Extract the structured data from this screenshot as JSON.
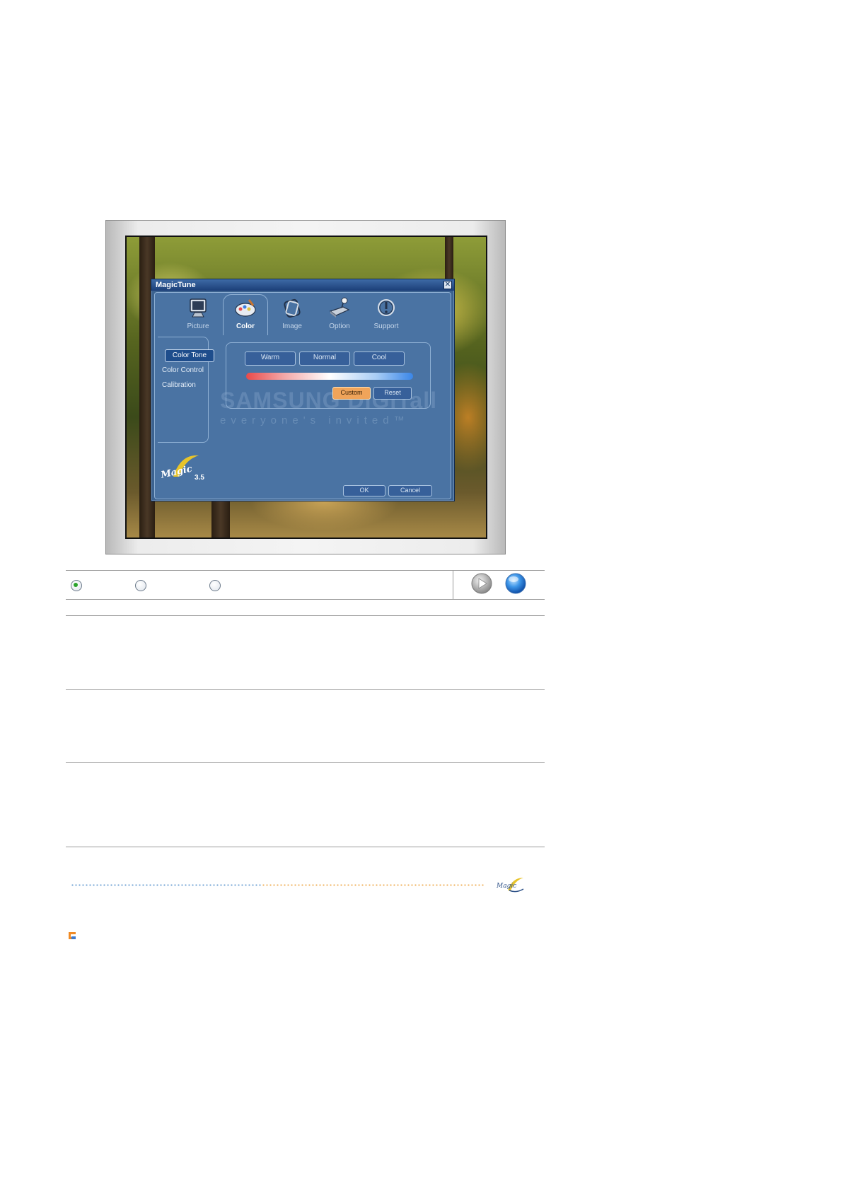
{
  "window": {
    "title": "MagicTune",
    "close_glyph": "✕",
    "version": "3.5"
  },
  "tabs": [
    {
      "label": "Picture",
      "icon": "monitor-icon"
    },
    {
      "label": "Color",
      "icon": "palette-icon"
    },
    {
      "label": "Image",
      "icon": "image-icon"
    },
    {
      "label": "Option",
      "icon": "option-icon"
    },
    {
      "label": "Support",
      "icon": "support-icon"
    }
  ],
  "active_tab": "Color",
  "side_menu": [
    {
      "label": "Color Tone"
    },
    {
      "label": "Color Control"
    },
    {
      "label": "Calibration"
    }
  ],
  "active_menu": "Color Tone",
  "presets": [
    {
      "label": "Warm"
    },
    {
      "label": "Normal"
    },
    {
      "label": "Cool"
    }
  ],
  "buttons": {
    "custom": "Custom",
    "reset": "Reset",
    "ok": "OK",
    "cancel": "Cancel"
  },
  "watermark": {
    "brand": "SAMSUNG DIGITall",
    "tagline": "everyone's invited™"
  },
  "colors": {
    "window_bg": "#3c628f",
    "active_button": "#f0a45a",
    "radio_selected": "#2aa32a"
  },
  "nav": {
    "radios": [
      {
        "selected": true
      },
      {
        "selected": false
      },
      {
        "selected": false
      }
    ],
    "play_icon": "play-icon",
    "orb_icon": "orb-icon"
  }
}
